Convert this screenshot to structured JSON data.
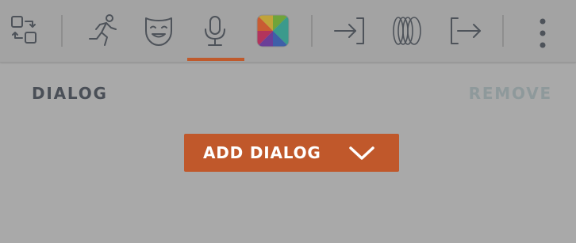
{
  "toolbar": {
    "tools": [
      {
        "icon": "transform-swap-icon"
      },
      {
        "icon": "running-figure-icon"
      },
      {
        "icon": "theater-mask-icon"
      },
      {
        "icon": "microphone-icon",
        "active": true
      },
      {
        "icon": "color-palette-icon"
      },
      {
        "icon": "enter-arrow-icon"
      },
      {
        "icon": "stacked-rings-icon"
      },
      {
        "icon": "exit-arrow-icon"
      },
      {
        "icon": "more-vertical-icon"
      }
    ],
    "accent_color": "#bf5a2c"
  },
  "panel": {
    "title": "DIALOG",
    "remove_label": "REMOVE",
    "add_button_label": "ADD DIALOG"
  }
}
